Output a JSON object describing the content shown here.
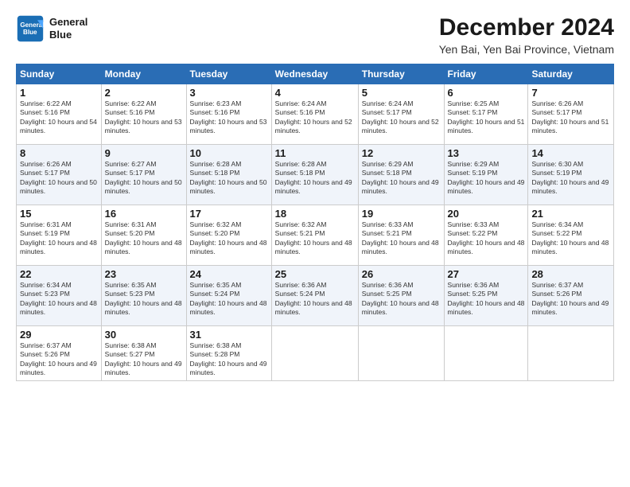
{
  "header": {
    "logo_line1": "General",
    "logo_line2": "Blue",
    "title": "December 2024",
    "subtitle": "Yen Bai, Yen Bai Province, Vietnam"
  },
  "weekdays": [
    "Sunday",
    "Monday",
    "Tuesday",
    "Wednesday",
    "Thursday",
    "Friday",
    "Saturday"
  ],
  "weeks": [
    [
      {
        "day": "1",
        "sunrise": "6:22 AM",
        "sunset": "5:16 PM",
        "daylight": "10 hours and 54 minutes."
      },
      {
        "day": "2",
        "sunrise": "6:22 AM",
        "sunset": "5:16 PM",
        "daylight": "10 hours and 53 minutes."
      },
      {
        "day": "3",
        "sunrise": "6:23 AM",
        "sunset": "5:16 PM",
        "daylight": "10 hours and 53 minutes."
      },
      {
        "day": "4",
        "sunrise": "6:24 AM",
        "sunset": "5:16 PM",
        "daylight": "10 hours and 52 minutes."
      },
      {
        "day": "5",
        "sunrise": "6:24 AM",
        "sunset": "5:17 PM",
        "daylight": "10 hours and 52 minutes."
      },
      {
        "day": "6",
        "sunrise": "6:25 AM",
        "sunset": "5:17 PM",
        "daylight": "10 hours and 51 minutes."
      },
      {
        "day": "7",
        "sunrise": "6:26 AM",
        "sunset": "5:17 PM",
        "daylight": "10 hours and 51 minutes."
      }
    ],
    [
      {
        "day": "8",
        "sunrise": "6:26 AM",
        "sunset": "5:17 PM",
        "daylight": "10 hours and 50 minutes."
      },
      {
        "day": "9",
        "sunrise": "6:27 AM",
        "sunset": "5:17 PM",
        "daylight": "10 hours and 50 minutes."
      },
      {
        "day": "10",
        "sunrise": "6:28 AM",
        "sunset": "5:18 PM",
        "daylight": "10 hours and 50 minutes."
      },
      {
        "day": "11",
        "sunrise": "6:28 AM",
        "sunset": "5:18 PM",
        "daylight": "10 hours and 49 minutes."
      },
      {
        "day": "12",
        "sunrise": "6:29 AM",
        "sunset": "5:18 PM",
        "daylight": "10 hours and 49 minutes."
      },
      {
        "day": "13",
        "sunrise": "6:29 AM",
        "sunset": "5:19 PM",
        "daylight": "10 hours and 49 minutes."
      },
      {
        "day": "14",
        "sunrise": "6:30 AM",
        "sunset": "5:19 PM",
        "daylight": "10 hours and 49 minutes."
      }
    ],
    [
      {
        "day": "15",
        "sunrise": "6:31 AM",
        "sunset": "5:19 PM",
        "daylight": "10 hours and 48 minutes."
      },
      {
        "day": "16",
        "sunrise": "6:31 AM",
        "sunset": "5:20 PM",
        "daylight": "10 hours and 48 minutes."
      },
      {
        "day": "17",
        "sunrise": "6:32 AM",
        "sunset": "5:20 PM",
        "daylight": "10 hours and 48 minutes."
      },
      {
        "day": "18",
        "sunrise": "6:32 AM",
        "sunset": "5:21 PM",
        "daylight": "10 hours and 48 minutes."
      },
      {
        "day": "19",
        "sunrise": "6:33 AM",
        "sunset": "5:21 PM",
        "daylight": "10 hours and 48 minutes."
      },
      {
        "day": "20",
        "sunrise": "6:33 AM",
        "sunset": "5:22 PM",
        "daylight": "10 hours and 48 minutes."
      },
      {
        "day": "21",
        "sunrise": "6:34 AM",
        "sunset": "5:22 PM",
        "daylight": "10 hours and 48 minutes."
      }
    ],
    [
      {
        "day": "22",
        "sunrise": "6:34 AM",
        "sunset": "5:23 PM",
        "daylight": "10 hours and 48 minutes."
      },
      {
        "day": "23",
        "sunrise": "6:35 AM",
        "sunset": "5:23 PM",
        "daylight": "10 hours and 48 minutes."
      },
      {
        "day": "24",
        "sunrise": "6:35 AM",
        "sunset": "5:24 PM",
        "daylight": "10 hours and 48 minutes."
      },
      {
        "day": "25",
        "sunrise": "6:36 AM",
        "sunset": "5:24 PM",
        "daylight": "10 hours and 48 minutes."
      },
      {
        "day": "26",
        "sunrise": "6:36 AM",
        "sunset": "5:25 PM",
        "daylight": "10 hours and 48 minutes."
      },
      {
        "day": "27",
        "sunrise": "6:36 AM",
        "sunset": "5:25 PM",
        "daylight": "10 hours and 48 minutes."
      },
      {
        "day": "28",
        "sunrise": "6:37 AM",
        "sunset": "5:26 PM",
        "daylight": "10 hours and 49 minutes."
      }
    ],
    [
      {
        "day": "29",
        "sunrise": "6:37 AM",
        "sunset": "5:26 PM",
        "daylight": "10 hours and 49 minutes."
      },
      {
        "day": "30",
        "sunrise": "6:38 AM",
        "sunset": "5:27 PM",
        "daylight": "10 hours and 49 minutes."
      },
      {
        "day": "31",
        "sunrise": "6:38 AM",
        "sunset": "5:28 PM",
        "daylight": "10 hours and 49 minutes."
      },
      null,
      null,
      null,
      null
    ]
  ]
}
